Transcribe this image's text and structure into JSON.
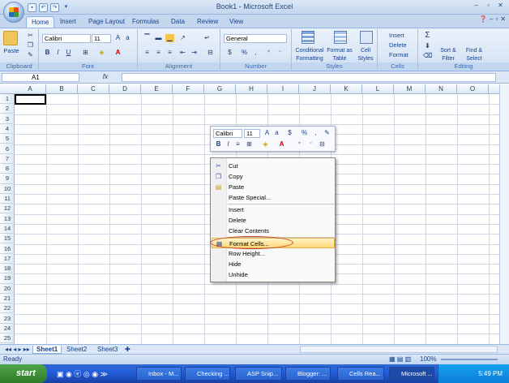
{
  "app": {
    "title": "Book1 - Microsoft Excel"
  },
  "tabs": [
    "Home",
    "Insert",
    "Page Layout",
    "Formulas",
    "Data",
    "Review",
    "View"
  ],
  "ribbon": {
    "clipboard": {
      "label": "Clipboard",
      "paste": "Paste"
    },
    "font": {
      "label": "Font",
      "family": "Calibri",
      "size": "11"
    },
    "alignment": {
      "label": "Alignment"
    },
    "number": {
      "label": "Number",
      "format": "General",
      "currency": "$",
      "percent": "%",
      "comma": ","
    },
    "styles": {
      "label": "Styles",
      "conditional": "Conditional Formatting",
      "format_table": "Format as Table",
      "cell_styles": "Cell Styles"
    },
    "cells": {
      "label": "Cells",
      "insert": "Insert",
      "delete": "Delete",
      "format": "Format"
    },
    "editing": {
      "label": "Editing",
      "sort": "Sort & Filter",
      "find": "Find & Select",
      "sigma": "Σ"
    }
  },
  "formula_bar": {
    "name_box": "A1",
    "fx": "fx"
  },
  "columns": [
    "A",
    "B",
    "C",
    "D",
    "E",
    "F",
    "G",
    "H",
    "I",
    "J",
    "K",
    "L",
    "M",
    "N",
    "O"
  ],
  "rows": [
    "1",
    "2",
    "3",
    "4",
    "5",
    "6",
    "7",
    "8",
    "9",
    "10",
    "11",
    "12",
    "13",
    "14",
    "15",
    "16",
    "17",
    "18",
    "19",
    "20",
    "21",
    "22",
    "23",
    "24",
    "25"
  ],
  "sheets": [
    "Sheet1",
    "Sheet2",
    "Sheet3"
  ],
  "status": {
    "ready": "Ready",
    "zoom": "100%"
  },
  "mini_toolbar": {
    "font": "Calibri",
    "size": "11",
    "currency": "$",
    "percent": "%",
    "comma": ","
  },
  "context_menu": {
    "cut": "Cut",
    "copy": "Copy",
    "paste": "Paste",
    "paste_special": "Paste Special...",
    "insert": "Insert",
    "delete": "Delete",
    "clear_contents": "Clear Contents",
    "format_cells": "Format Cells...",
    "row_height": "Row Height...",
    "hide": "Hide",
    "unhide": "Unhide"
  },
  "taskbar": {
    "start": "start",
    "tasks": [
      "Inbox - M...",
      "Checking ...",
      "ASP Snip...",
      "Blogger: ...",
      "Cells Rea...",
      "Microsoft ..."
    ],
    "clock": "5:49 PM"
  }
}
